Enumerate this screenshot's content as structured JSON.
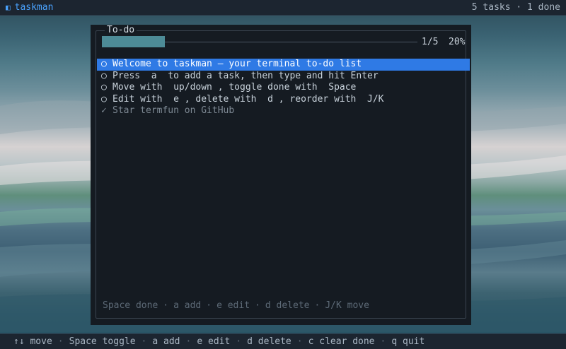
{
  "app": {
    "icon": "window-icon",
    "title": "taskman",
    "status": "5 tasks · 1 done"
  },
  "panel": {
    "title": "To-do",
    "progress": {
      "fraction": 0.2,
      "count": "1/5",
      "percent": "20%"
    },
    "tasks": [
      {
        "mark": "○",
        "text": "Welcome to taskman – your terminal to-do list",
        "done": false,
        "selected": true
      },
      {
        "mark": "○",
        "text": "Press  a  to add a task, then type and hit Enter",
        "done": false,
        "selected": false
      },
      {
        "mark": "○",
        "text": "Move with  up/down , toggle done with  Space",
        "done": false,
        "selected": false
      },
      {
        "mark": "○",
        "text": "Edit with  e , delete with  d , reorder with  J/K",
        "done": false,
        "selected": false
      },
      {
        "mark": "✓",
        "text": "Star termfun on GitHub",
        "done": true,
        "selected": false
      }
    ],
    "footer_hints": [
      "Space done",
      "a add",
      "e edit",
      "d delete",
      "J/K move"
    ],
    "footer_sep": "·"
  },
  "bottom_bar": {
    "hints": [
      "↑↓ move",
      "Space toggle",
      "a add",
      "e edit",
      "d delete",
      "c clear done",
      "q quit"
    ],
    "sep": "·"
  },
  "colors": {
    "accent": "#2f7ae5",
    "progress_fill": "#4d8b97",
    "title_blue": "#4aa3ff"
  }
}
